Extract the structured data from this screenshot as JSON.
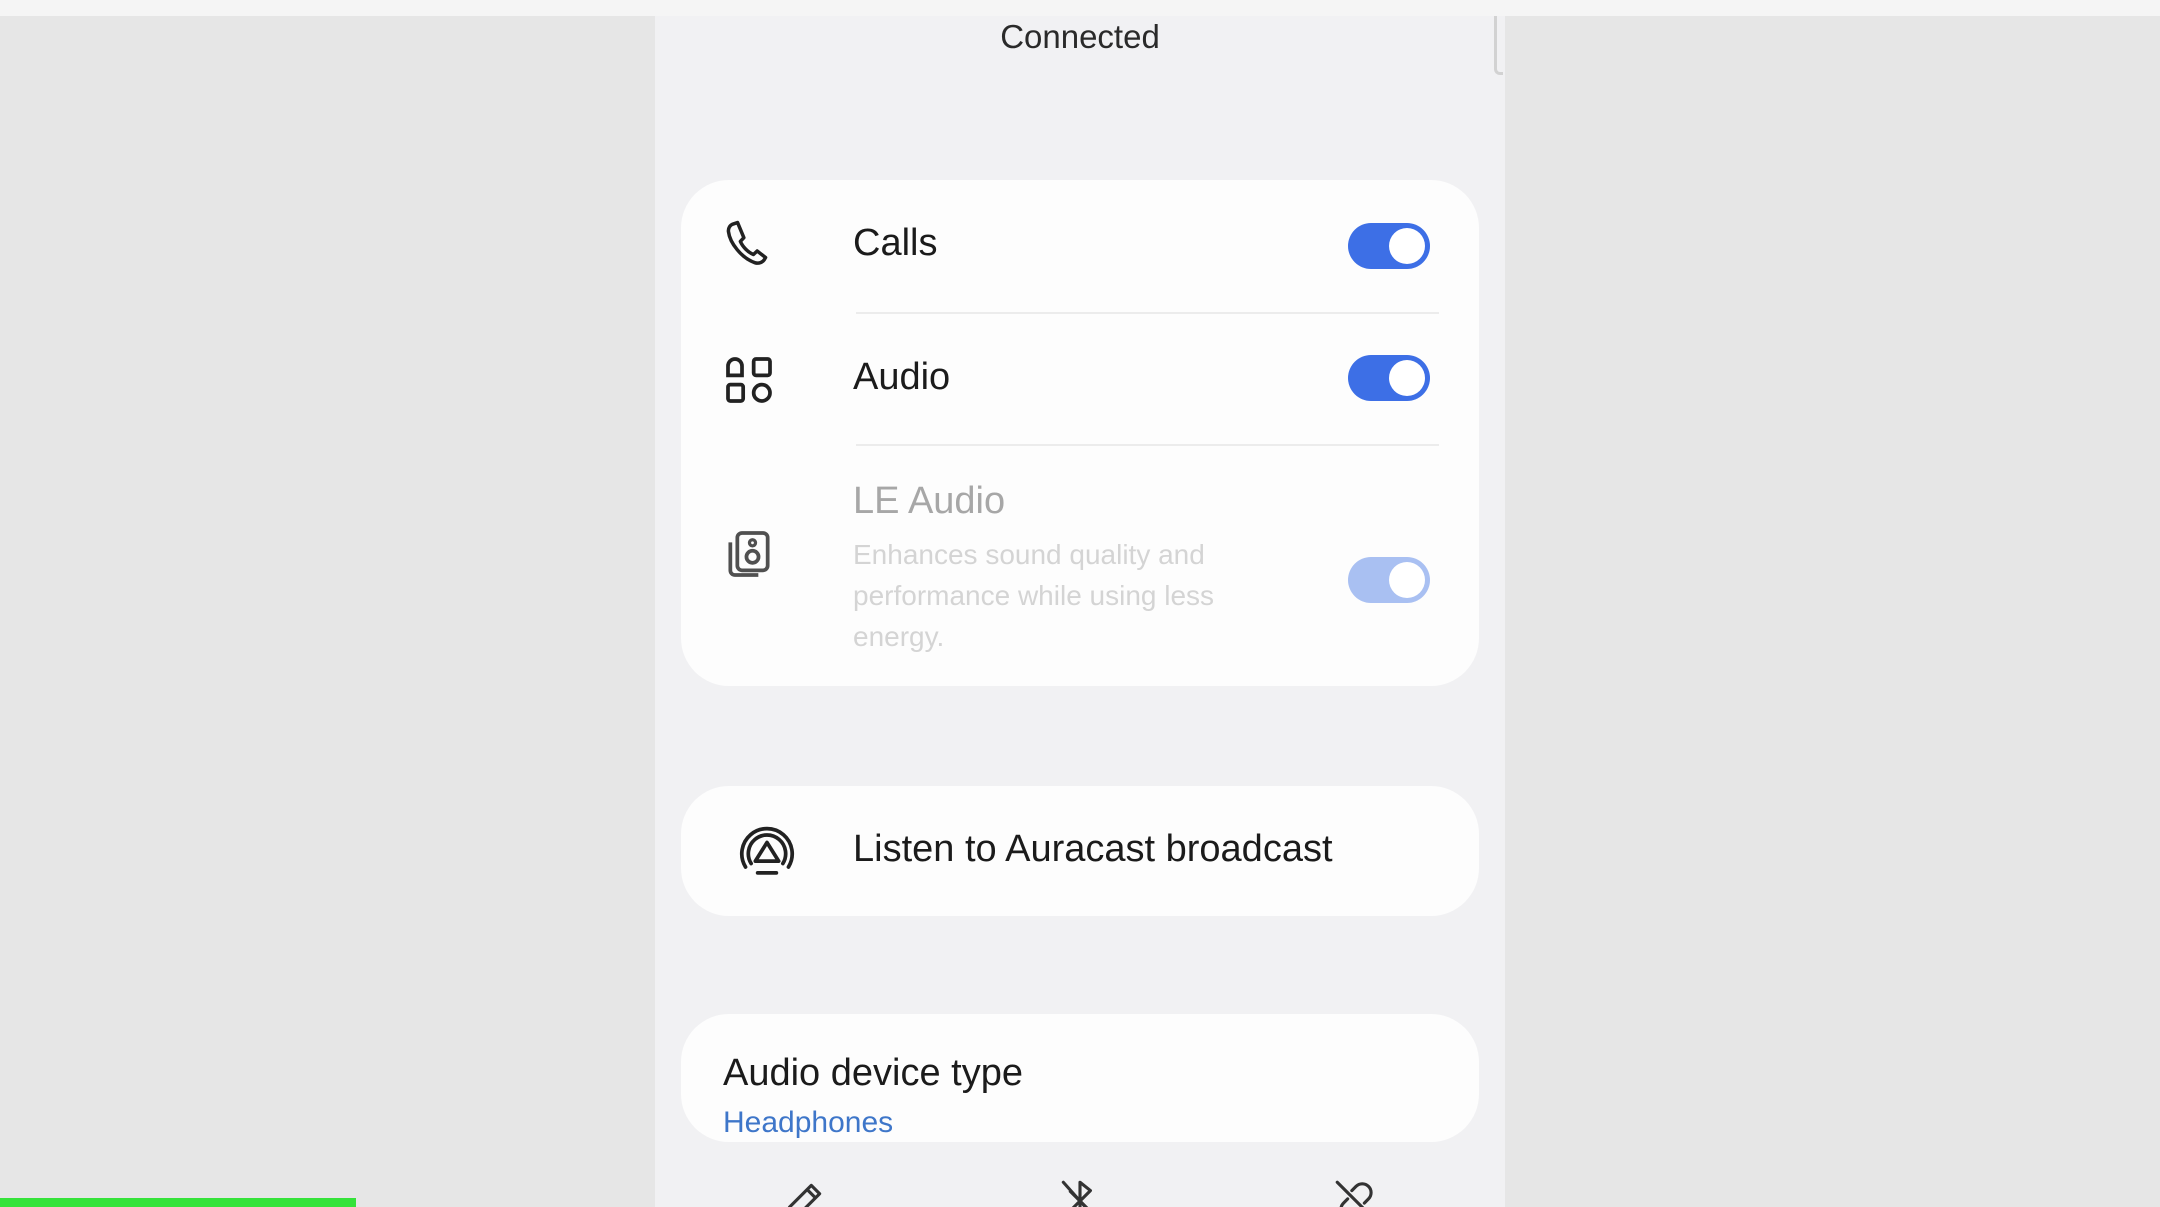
{
  "header": {
    "status": "Connected"
  },
  "toggles": [
    {
      "label": "Calls",
      "icon": "phone-icon",
      "enabled": true
    },
    {
      "label": "Audio",
      "icon": "apps-grid-icon",
      "enabled": true
    },
    {
      "label": "LE Audio",
      "icon": "speaker-icon",
      "enabled": true,
      "disabled": true,
      "description": "Enhances sound quality and performance while using less energy."
    }
  ],
  "auracast": {
    "label": "Listen to Auracast broadcast",
    "icon": "auracast-icon"
  },
  "device_type": {
    "title": "Audio device type",
    "value": "Headphones"
  },
  "bottom_actions": [
    {
      "icon": "pencil-icon"
    },
    {
      "icon": "bluetooth-off-icon"
    },
    {
      "icon": "unlink-icon"
    }
  ],
  "video_progress": 0.165,
  "colors": {
    "accent": "#3d6fe6",
    "link": "#3e76c9",
    "progress": "#35e23a"
  }
}
